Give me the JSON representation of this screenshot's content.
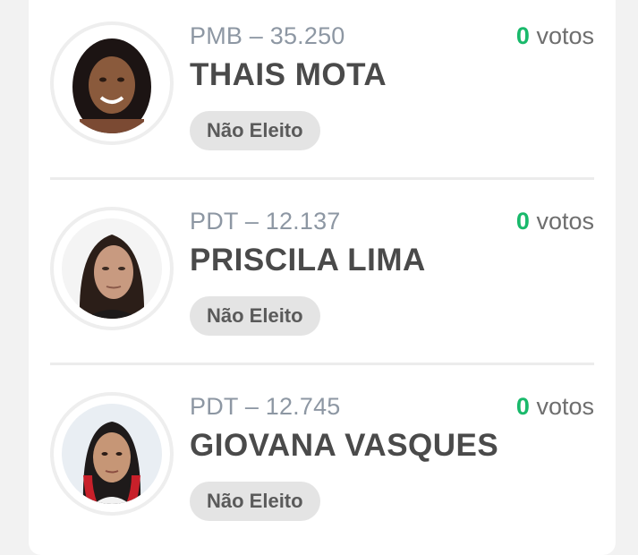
{
  "candidates": [
    {
      "party_number": "PMB – 35.250",
      "name": "THAIS MOTA",
      "votes_count": "0",
      "votes_label": "votos",
      "status": "Não Eleito",
      "photo_icon": "candidate-photo-thais-mota"
    },
    {
      "party_number": "PDT – 12.137",
      "name": "PRISCILA LIMA",
      "votes_count": "0",
      "votes_label": "votos",
      "status": "Não Eleito",
      "photo_icon": "candidate-photo-priscila-lima"
    },
    {
      "party_number": "PDT – 12.745",
      "name": "GIOVANA VASQUES",
      "votes_count": "0",
      "votes_label": "votos",
      "status": "Não Eleito",
      "photo_icon": "candidate-photo-giovana-vasques"
    }
  ],
  "colors": {
    "votes_count": "#19b96b",
    "party_text": "#8d97a3",
    "name_text": "#4a4a4a",
    "badge_bg": "#e4e4e4"
  }
}
